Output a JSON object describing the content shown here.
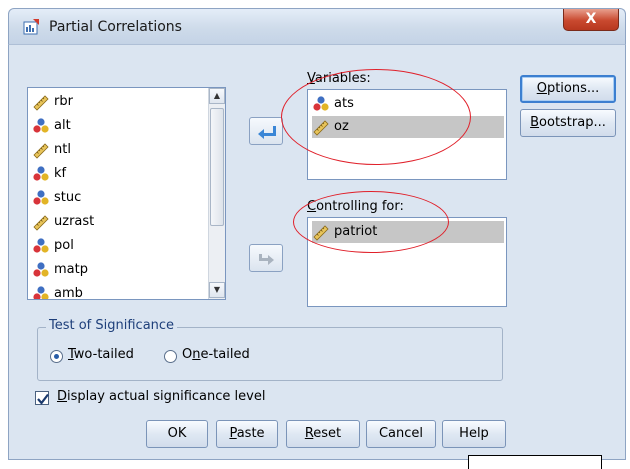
{
  "window": {
    "title": "Partial Correlations",
    "close_glyph": "X"
  },
  "source_list": {
    "items": [
      {
        "label": "rbr",
        "icon": "ruler-scale-icon"
      },
      {
        "label": "alt",
        "icon": "nominal-balls-icon"
      },
      {
        "label": "ntl",
        "icon": "ruler-scale-icon"
      },
      {
        "label": "kf",
        "icon": "nominal-balls-icon"
      },
      {
        "label": "stuc",
        "icon": "nominal-balls-icon"
      },
      {
        "label": "uzrast",
        "icon": "ruler-scale-icon"
      },
      {
        "label": "pol",
        "icon": "nominal-balls-icon"
      },
      {
        "label": "matp",
        "icon": "nominal-balls-icon"
      },
      {
        "label": "amb",
        "icon": "nominal-balls-icon"
      }
    ]
  },
  "variables": {
    "label_pre": "",
    "label_ul": "V",
    "label_post": "ariables:",
    "items": [
      {
        "label": "ats",
        "icon": "nominal-balls-icon",
        "selected": false
      },
      {
        "label": "oz",
        "icon": "ruler-scale-icon",
        "selected": true
      }
    ]
  },
  "controlling": {
    "label_pre": "",
    "label_ul": "C",
    "label_post": "ontrolling for:",
    "items": [
      {
        "label": "patriot",
        "icon": "ruler-scale-icon",
        "selected": true
      }
    ]
  },
  "side_buttons": {
    "options_pre": "",
    "options_ul": "O",
    "options_post": "ptions...",
    "bootstrap_pre": "",
    "bootstrap_ul": "B",
    "bootstrap_post": "ootstrap..."
  },
  "significance": {
    "legend": "Test of Significance",
    "two_pre": "",
    "two_ul": "T",
    "two_post": "wo-tailed",
    "one_pre": "O",
    "one_ul": "n",
    "one_post": "e-tailed",
    "selected": "two-tailed"
  },
  "display_flag": {
    "pre": "",
    "ul": "D",
    "post": "isplay actual significance level",
    "checked": true
  },
  "bottom_buttons": {
    "ok": "OK",
    "paste_pre": "",
    "paste_ul": "P",
    "paste_post": "aste",
    "reset_pre": "",
    "reset_ul": "R",
    "reset_post": "eset",
    "cancel": "Cancel",
    "help": "Help"
  },
  "colors": {
    "dialog_bg": "#dbe5f1",
    "arrow_blue": "#3a86d6",
    "annotation_red": "#e0202a"
  }
}
